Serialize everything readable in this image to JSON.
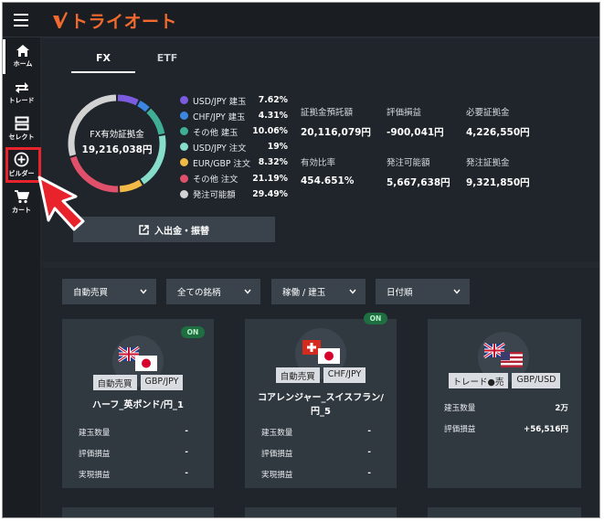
{
  "header": {
    "logo_text": "トライオート",
    "brand_color": "#f26a2e"
  },
  "sidebar": {
    "items": [
      {
        "label": "ホーム",
        "icon": "home-icon"
      },
      {
        "label": "トレード",
        "icon": "trade-arrows-icon"
      },
      {
        "label": "セレクト",
        "icon": "select-icon"
      },
      {
        "label": "ビルダー",
        "icon": "builder-plus-icon"
      },
      {
        "label": "カート",
        "icon": "cart-icon"
      }
    ]
  },
  "tabs": [
    {
      "label": "FX"
    },
    {
      "label": "ETF"
    }
  ],
  "donut": {
    "label": "FX有効証拠金",
    "value": "19,216,038円",
    "segments": [
      {
        "label": "USD/JPY 建玉",
        "pct": "7.62%",
        "value": 7.62,
        "color": "#7b5be0"
      },
      {
        "label": "CHF/JPY 建玉",
        "pct": "4.31%",
        "value": 4.31,
        "color": "#3b86e0"
      },
      {
        "label": "その他 建玉",
        "pct": "10.06%",
        "value": 10.06,
        "color": "#3fae94"
      },
      {
        "label": "USD/JPY 注文",
        "pct": "19%",
        "value": 19,
        "color": "#86ddc9"
      },
      {
        "label": "EUR/GBP 注文",
        "pct": "8.32%",
        "value": 8.32,
        "color": "#f1b945"
      },
      {
        "label": "その他 注文",
        "pct": "21.19%",
        "value": 21.19,
        "color": "#e0506a"
      },
      {
        "label": "発注可能額",
        "pct": "29.49%",
        "value": 29.49,
        "color": "#d2d2d2"
      }
    ]
  },
  "stats": [
    {
      "label": "証拠金預託額",
      "value": "20,116,079円"
    },
    {
      "label": "評価損益",
      "value": "-900,041円"
    },
    {
      "label": "必要証拠金",
      "value": "4,226,550円"
    },
    {
      "label": "有効比率",
      "value": "454.651%"
    },
    {
      "label": "発注可能額",
      "value": "5,667,638円"
    },
    {
      "label": "発注証拠金",
      "value": "9,321,850円"
    }
  ],
  "deposit_button": {
    "label": "入出金・振替"
  },
  "filters": [
    {
      "label": "自動売買"
    },
    {
      "label": "全ての銘柄"
    },
    {
      "label": "稼働 / 建玉"
    },
    {
      "label": "日付順"
    }
  ],
  "cards": [
    {
      "badge": "ON",
      "tags": [
        "自動売買",
        "GBP/JPY"
      ],
      "flags": "GBP-JPY",
      "name": "ハーフ_英ポンド/円_1",
      "rows": [
        {
          "label": "建玉数量",
          "value": "-"
        },
        {
          "label": "評価損益",
          "value": "-"
        },
        {
          "label": "実現損益",
          "value": "-"
        }
      ]
    },
    {
      "badge": "ON",
      "tags": [
        "自動売買",
        "CHF/JPY"
      ],
      "flags": "CHF-JPY",
      "name": "コアレンジャー_スイスフラン/円_5",
      "rows": [
        {
          "label": "建玉数量",
          "value": "-"
        },
        {
          "label": "評価損益",
          "value": "-"
        },
        {
          "label": "実現損益",
          "value": "-"
        }
      ]
    },
    {
      "badge": "",
      "tags": [
        "トレード●売",
        "GBP/USD"
      ],
      "flags": "GBP-USD",
      "name": "",
      "rows": [
        {
          "label": "建玉数量",
          "value": "2万"
        },
        {
          "label": "評価損益",
          "value": "+56,516円"
        }
      ]
    }
  ]
}
